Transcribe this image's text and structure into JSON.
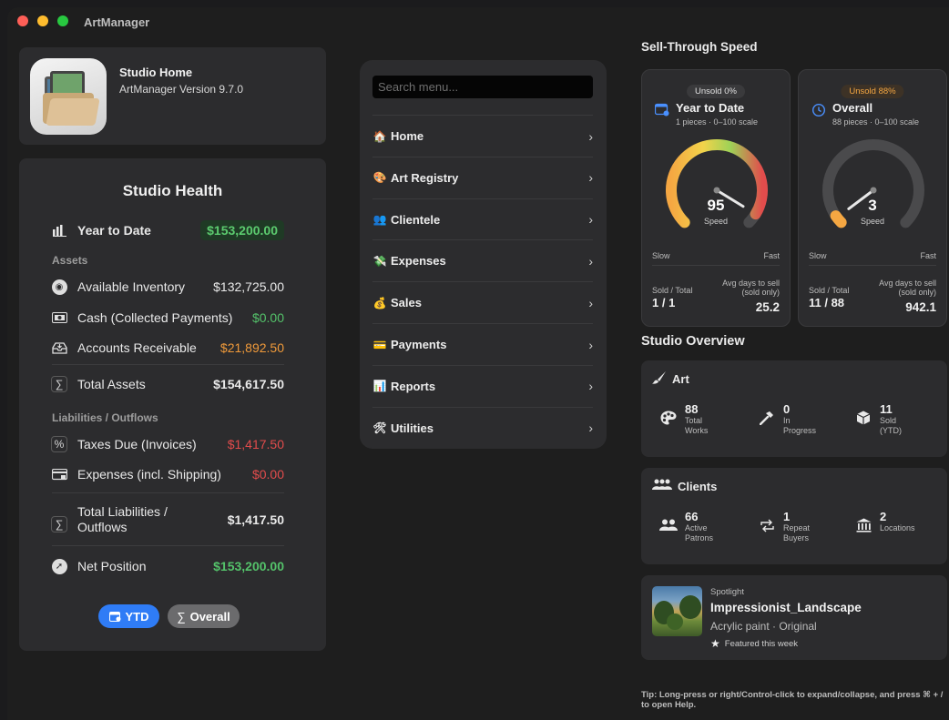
{
  "window": {
    "title": "ArtManager",
    "traffic_lights": {
      "close": "#fe5f57",
      "minimize": "#febc2e",
      "zoom": "#28c840"
    }
  },
  "studio_home": {
    "name": "Studio Home",
    "version": "ArtManager Version 9.7.0"
  },
  "studio_health": {
    "title": "Studio Health",
    "ytd_label": "Year to Date",
    "ytd_value": "$153,200.00",
    "assets_header": "Assets",
    "available_inventory": {
      "label": "Available Inventory",
      "value": "$132,725.00"
    },
    "cash": {
      "label": "Cash (Collected Payments)",
      "value": "$0.00"
    },
    "receivable": {
      "label": "Accounts Receivable",
      "value": "$21,892.50"
    },
    "total_assets": {
      "label": "Total Assets",
      "value": "$154,617.50"
    },
    "liabilities_header": "Liabilities / Outflows",
    "taxes": {
      "label": "Taxes Due (Invoices)",
      "value": "$1,417.50"
    },
    "expenses": {
      "label": "Expenses (incl. Shipping)",
      "value": "$0.00"
    },
    "total_liabilities": {
      "label_line1": "Total Liabilities /",
      "label_line2": "Outflows",
      "value": "$1,417.50"
    },
    "net_position": {
      "label": "Net Position",
      "value": "$153,200.00"
    },
    "toggle": {
      "ytd": "YTD",
      "overall": "Overall",
      "selected": "YTD"
    },
    "colors": {
      "positive": "#54c26a",
      "receivable": "#f09a3a",
      "negative": "#e24c4c",
      "accent": "#2f7cf6"
    }
  },
  "menu": {
    "search_placeholder": "Search menu...",
    "items": [
      {
        "icon": "house-icon",
        "glyph": "🏠",
        "label": "Home"
      },
      {
        "icon": "palette-icon",
        "glyph": "🎨",
        "label": "Art Registry"
      },
      {
        "icon": "people-icon",
        "glyph": "👥",
        "label": "Clientele"
      },
      {
        "icon": "money-wings-icon",
        "glyph": "💸",
        "label": "Expenses"
      },
      {
        "icon": "money-bag-icon",
        "glyph": "💰",
        "label": "Sales"
      },
      {
        "icon": "credit-card-icon",
        "glyph": "💳",
        "label": "Payments"
      },
      {
        "icon": "bar-chart-icon",
        "glyph": "📊",
        "label": "Reports"
      },
      {
        "icon": "tools-icon",
        "glyph": "🛠",
        "label": "Utilities"
      }
    ]
  },
  "sell_through": {
    "title": "Sell-Through Speed",
    "ytd": {
      "badge": "Unsold 0%",
      "title": "Year to Date",
      "subtitle": "1 pieces · 0–100 scale",
      "value": "95",
      "speed_label": "Speed",
      "slow": "Slow",
      "fast": "Fast",
      "sold_total_label": "Sold / Total",
      "sold_total": "1 / 1",
      "avg_days_label": "Avg days to sell (sold only)",
      "avg_days": "25.2",
      "level": 0.95
    },
    "overall": {
      "badge": "Unsold 88%",
      "badge_color": "#f5a742",
      "title": "Overall",
      "subtitle": "88 pieces · 0–100 scale",
      "value": "3",
      "speed_label": "Speed",
      "slow": "Slow",
      "fast": "Fast",
      "sold_total_label": "Sold / Total",
      "sold_total": "11 / 88",
      "avg_days_label": "Avg days to sell (sold only)",
      "avg_days": "942.1",
      "level": 0.03
    }
  },
  "studio_overview": {
    "title": "Studio Overview",
    "art": {
      "title": "Art",
      "stats": [
        {
          "icon": "palette-icon",
          "value": "88",
          "label_1": "Total",
          "label_2": "Works"
        },
        {
          "icon": "hammer-icon",
          "value": "0",
          "label_1": "In",
          "label_2": "Progress"
        },
        {
          "icon": "box-icon",
          "value": "11",
          "label_1": "Sold",
          "label_2": "(YTD)"
        }
      ]
    },
    "clients": {
      "title": "Clients",
      "stats": [
        {
          "icon": "people-icon",
          "value": "66",
          "label_1": "Active",
          "label_2": "Patrons"
        },
        {
          "icon": "repeat-icon",
          "value": "1",
          "label_1": "Repeat",
          "label_2": "Buyers"
        },
        {
          "icon": "bank-icon",
          "value": "2",
          "label_1": "Locations",
          "label_2": ""
        }
      ]
    },
    "spotlight": {
      "kicker": "Spotlight",
      "name": "Impressionist_Landscape",
      "meta": "Acrylic paint · Original",
      "featured": "Featured this week"
    }
  },
  "tip": "Tip: Long-press or right/Control-click to expand/collapse, and press ⌘ + / to open Help."
}
